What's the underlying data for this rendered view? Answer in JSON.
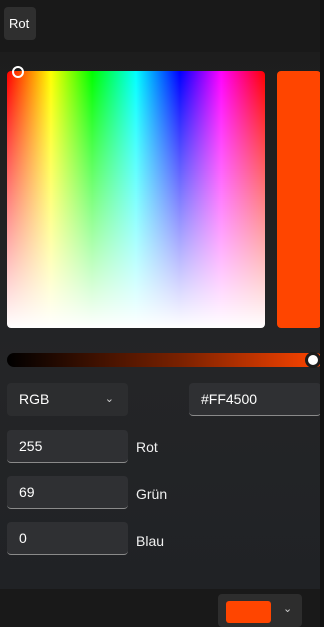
{
  "header": {
    "chip_label": "Rot"
  },
  "picker": {
    "current_color": "#FF4500",
    "mode": "RGB",
    "hex_value": "#FF4500",
    "red": {
      "value": "255",
      "label": "Rot"
    },
    "green": {
      "value": "69",
      "label": "Grün"
    },
    "blue": {
      "value": "0",
      "label": "Blau"
    },
    "value_level": 1.0,
    "chevron_icon": "chevron-down-icon"
  },
  "footer": {
    "selected_color": "#FF4500"
  }
}
